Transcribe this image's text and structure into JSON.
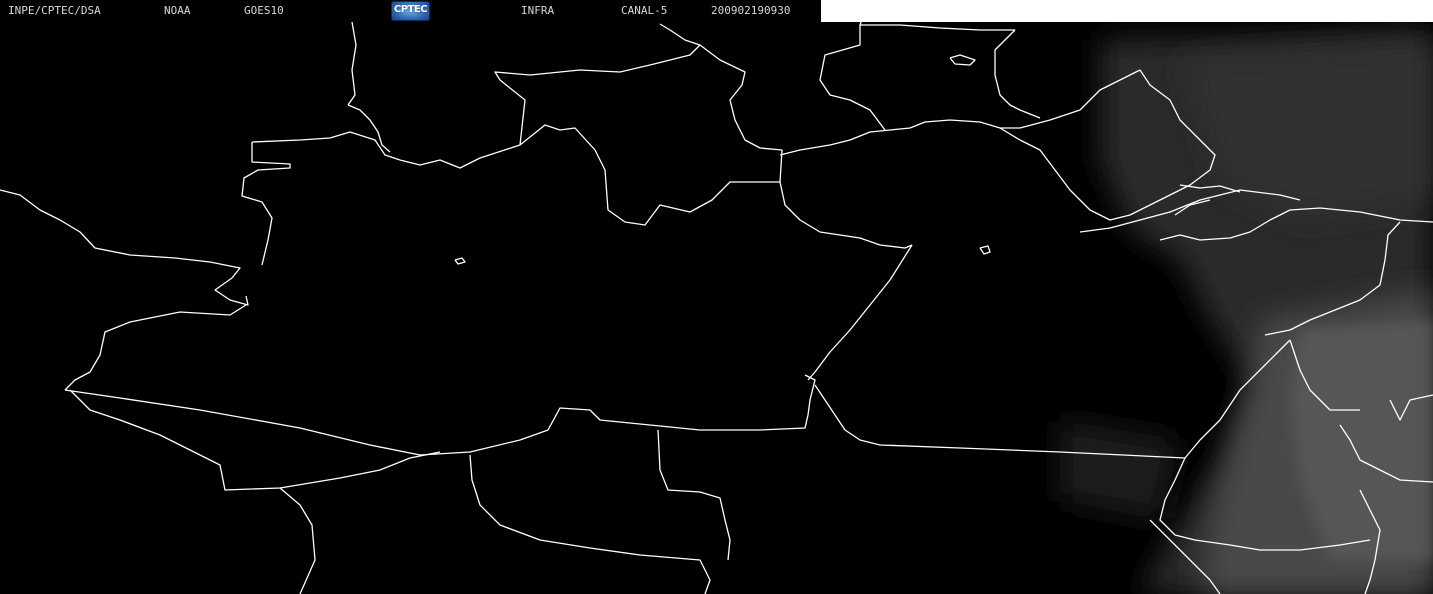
{
  "header": {
    "agency": "INPE/CPTEC/DSA",
    "organization": "NOAA",
    "satellite": "GOES10",
    "band": "INFRA",
    "channel": "CANAL-5",
    "timestamp": "200902190930",
    "logo_text": "CPTEC"
  },
  "colors": {
    "background": "#000000",
    "borders": "#ffffff",
    "header_text": "#d8d8d8",
    "cloud_tint": "#6a6a6a"
  },
  "icons": {
    "logo": "cptec-logo-icon"
  }
}
